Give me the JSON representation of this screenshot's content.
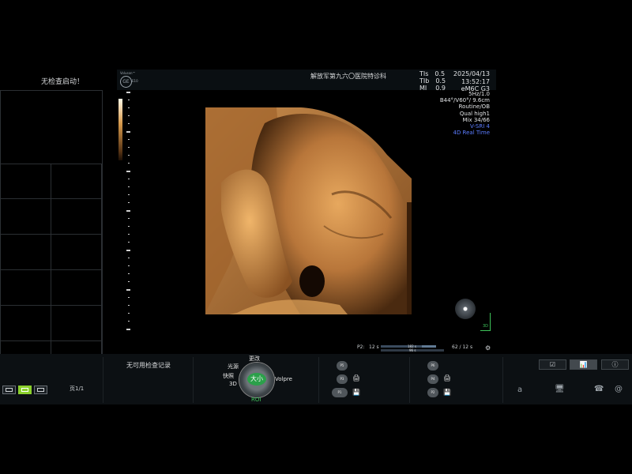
{
  "left_panel": {
    "exam_status": "无检查启动！",
    "page_label": "页1/1",
    "view_modes": [
      "single-view",
      "grid-view",
      "multi-grid-view"
    ],
    "active_view": "grid-view"
  },
  "header": {
    "logo_tag": "Voluson™",
    "logo_text": "GE",
    "logo_model": "E10",
    "hospital": "解放军第九六〇医院特诊科",
    "indices": [
      {
        "label": "TIs",
        "value": "0.5"
      },
      {
        "label": "TIb",
        "value": "0.5"
      },
      {
        "label": "MI",
        "value": "0.9"
      }
    ],
    "date": "2025/04/13",
    "time": "13:52:17",
    "probe": "eM6C G3"
  },
  "params": [
    "5Hz/1.0",
    "B44°/V60°/ 9.6cm",
    "Routine/OB",
    "Qual high1",
    "Mix 34/66"
  ],
  "params_blue": [
    "V-SRI 4",
    "4D Real Time"
  ],
  "axis_label": "3D",
  "cine": {
    "left_label": "P2:",
    "left_value": "12 s",
    "mid_top": "182 s",
    "mid_bottom": "96 s",
    "right_label": "62 / 12 s",
    "left_fill": 0.6,
    "top_fill": 0.45
  },
  "bottom": {
    "no_record": "无可用检查记录",
    "knob": {
      "center": "大小",
      "top": "更改",
      "left_top": "光源",
      "left_mid": "快照",
      "left_bottom": "3D",
      "right": "Volpre",
      "bottom": "ROI"
    },
    "presets_left": [
      "P5",
      "P3",
      "P1"
    ],
    "presets_right": [
      "P6",
      "P4",
      "P2"
    ],
    "tabs": [
      "☑",
      "📊",
      "ⓘ"
    ],
    "active_tab": 1,
    "sys": [
      "a",
      "🖥",
      "☎",
      "@"
    ]
  },
  "colors": {
    "accent": "#8bd02d",
    "roi": "#3ec45a",
    "blue_text": "#5b7cff",
    "render_tone": "#c98a44"
  }
}
